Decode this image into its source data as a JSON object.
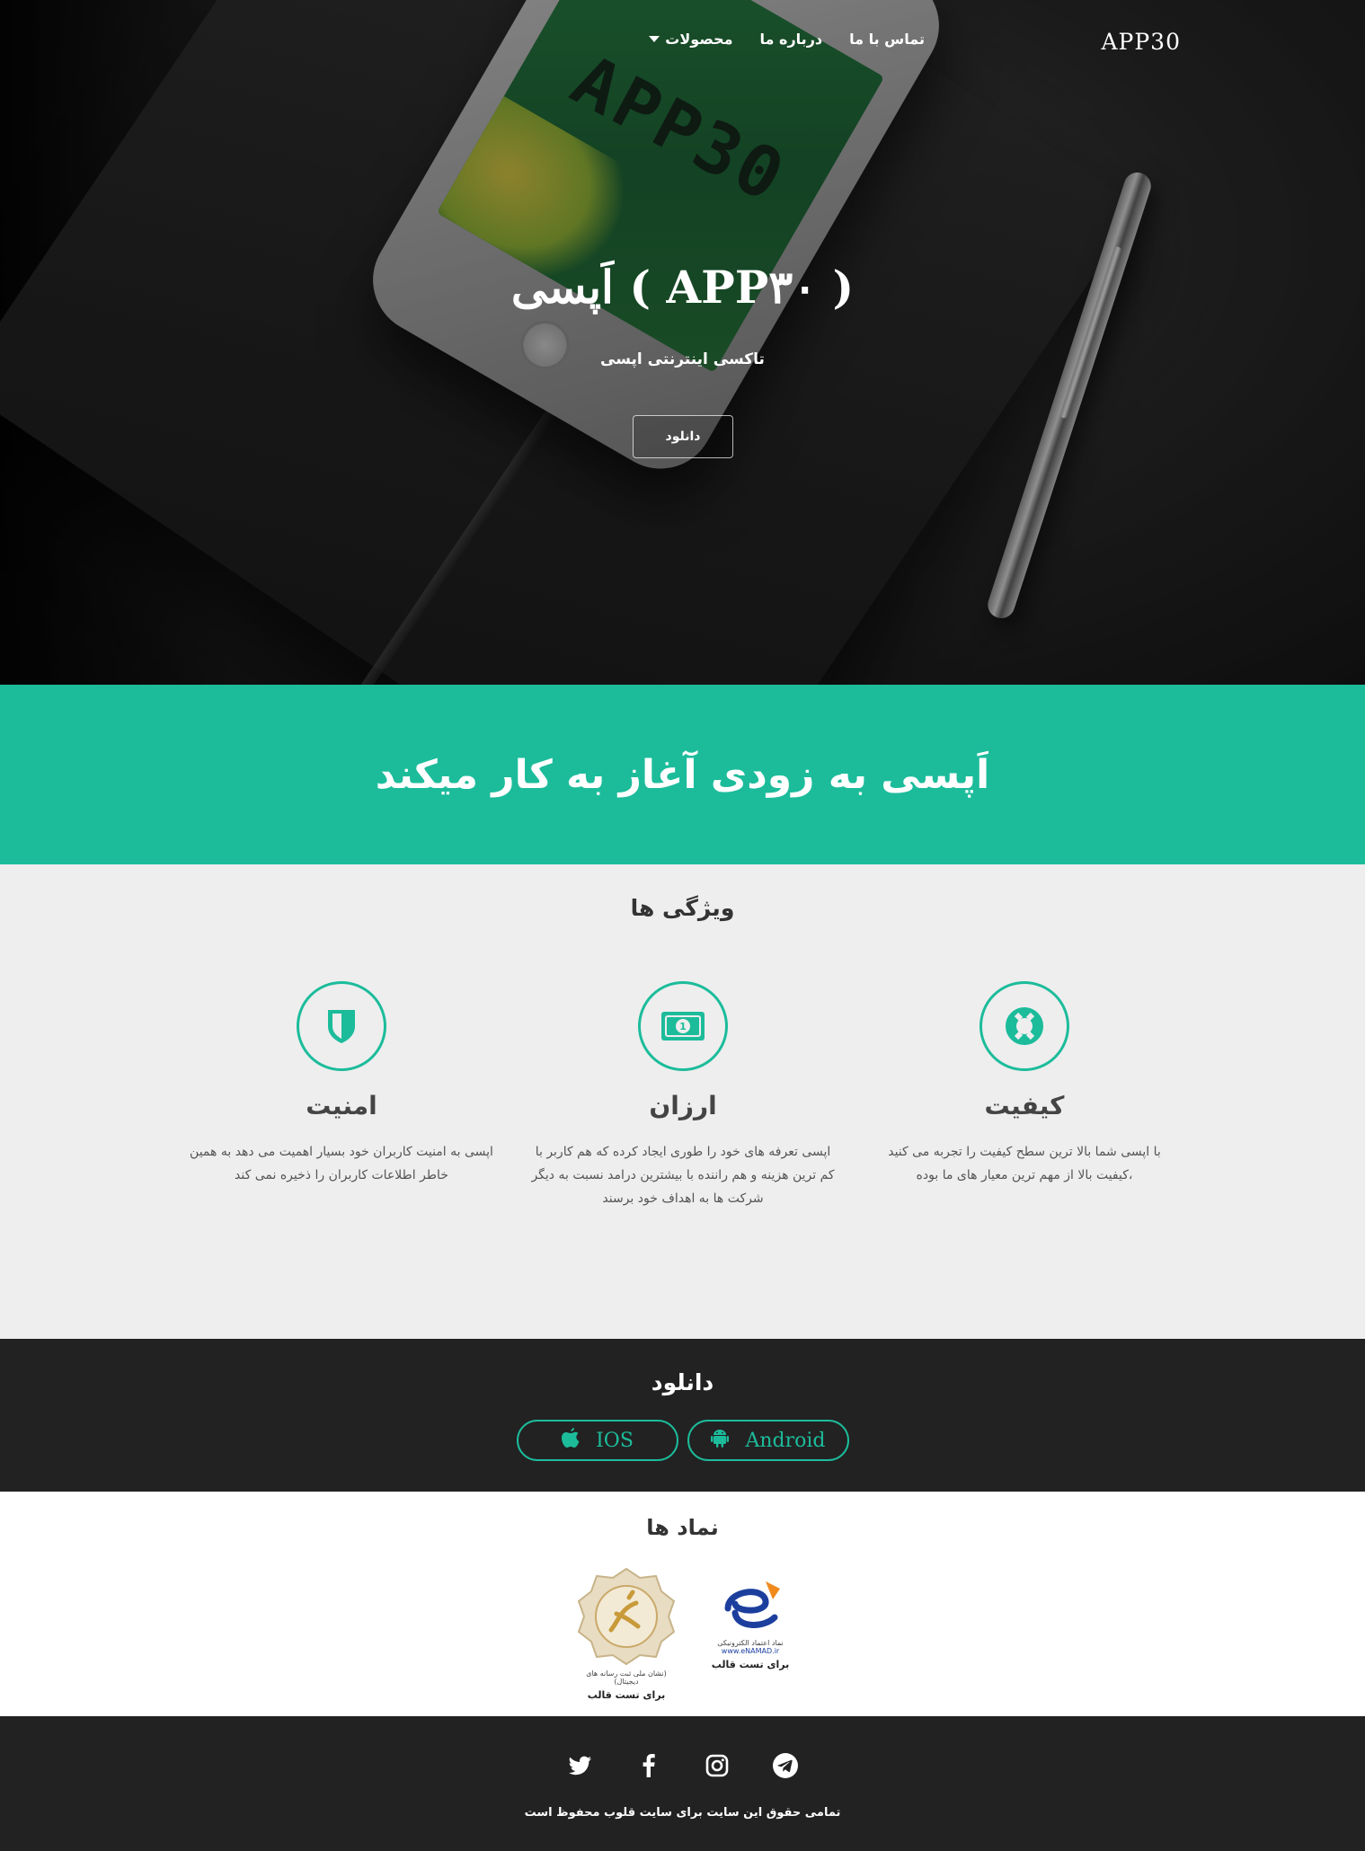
{
  "nav": {
    "brand": "APP30",
    "links": [
      {
        "label": "تماس با ما"
      },
      {
        "label": "درباره ما"
      },
      {
        "label": "محصولات"
      }
    ]
  },
  "hero": {
    "title": "( APP۳۰ ) اَپسی",
    "subtitle": "تاکسی اینترنتی اپسی",
    "download_label": "دانلود",
    "phone_logo": "APP30"
  },
  "banner": {
    "heading": "اَپسی به زودی آغاز به کار میکند"
  },
  "features": {
    "title": "ویژگی ها",
    "items": [
      {
        "icon": "lifebuoy-icon",
        "title": "کیفیت",
        "text": "با اپسی شما بالا ترین سطح کیفیت را تجربه می کنید ،کیفیت بالا از مهم ترین معیار های ما بوده"
      },
      {
        "icon": "money-bill-icon",
        "title": "ارزان",
        "text": "اپسی تعرفه های خود را طوری ایجاد کرده که هم کاربر با کم ترین هزینه و هم راننده با بیشترین درامد نسبت به دیگر شرکت ها به اهداف خود برسند"
      },
      {
        "icon": "shield-icon",
        "title": "امنیت",
        "text": "اپسی به امنیت کاربران خود بسیار اهمیت می دهد به همین خاطر اطلاعات کاربران را ذخیره نمی کند"
      }
    ]
  },
  "download": {
    "title": "دانلود",
    "ios_label": "IOS",
    "android_label": "Android"
  },
  "symbols": {
    "title": "نماد ها",
    "samandehi_caption": "برای تست قالب",
    "samandehi_small": "(نشان ملی ثبت رسانه های دیجیتال)",
    "enamad_caption": "برای تست قالب",
    "enamad_line1": "نماد اعتماد الکترونیکی",
    "enamad_line2": "www.eNAMAD.ir"
  },
  "footer": {
    "copyright": "تمامی حقوق این سایت برای سایت قلوب محفوظ است",
    "socials": [
      "twitter-icon",
      "facebook-icon",
      "instagram-icon",
      "telegram-icon"
    ]
  },
  "colors": {
    "accent": "#1cbc9b",
    "dark": "#222222",
    "light_bg": "#eeeeee"
  }
}
